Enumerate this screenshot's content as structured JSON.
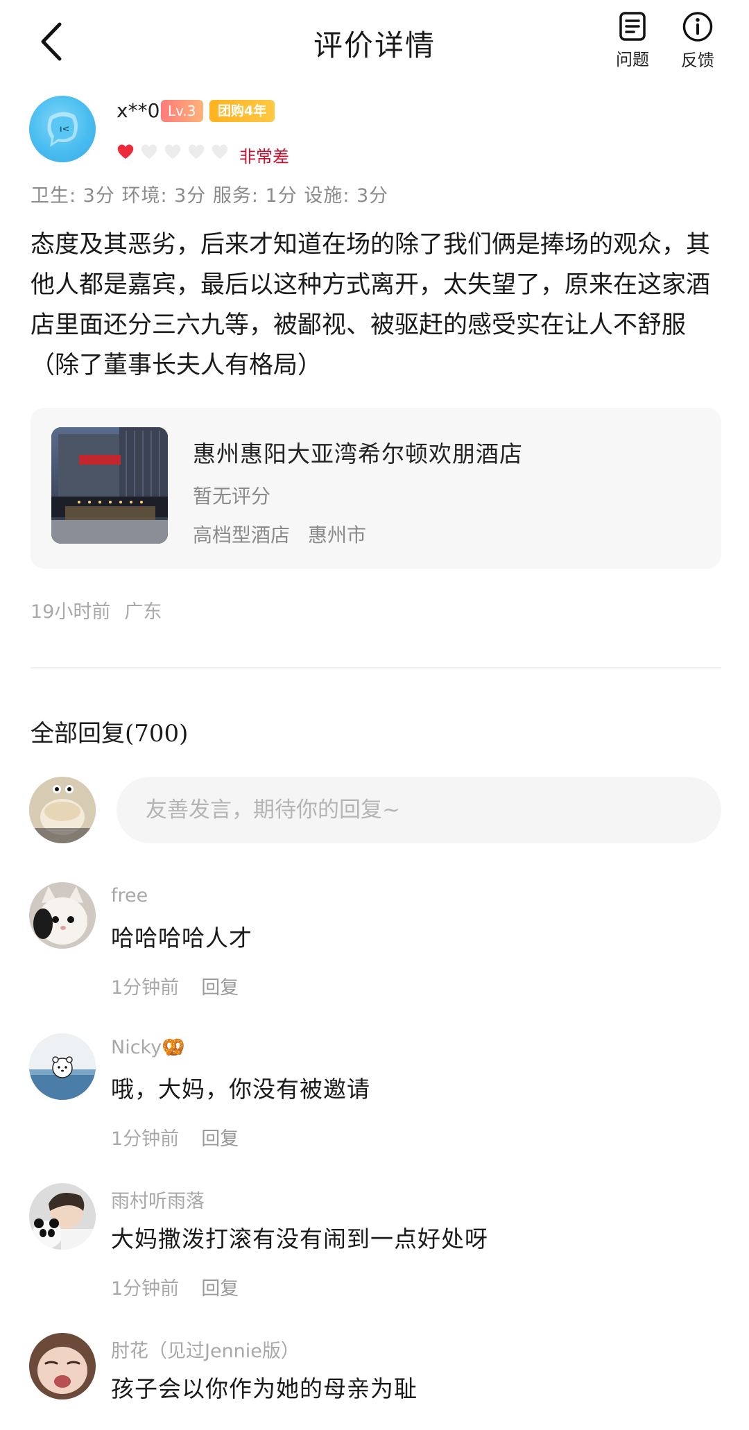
{
  "header": {
    "title": "评价详情",
    "question_label": "问题",
    "feedback_label": "反馈"
  },
  "reviewer": {
    "username": "x**0",
    "level_badge": "Lv.3",
    "years_badge": "团购4年",
    "rating_hearts_filled": 1,
    "rating_hearts_total": 5,
    "rating_text": "非常差",
    "subscores": "卫生: 3分 环境: 3分 服务: 1分 设施: 3分"
  },
  "review": {
    "body": "态度及其恶劣，后来才知道在场的除了我们俩是捧场的观众，其他人都是嘉宾，最后以这种方式离开，太失望了，原来在这家酒店里面还分三六九等，被鄙视、被驱赶的感受实在让人不舒服（除了董事长夫人有格局）"
  },
  "hotel": {
    "name": "惠州惠阳大亚湾希尔顿欢朋酒店",
    "score": "暂无评分",
    "category": "高档型酒店",
    "city": "惠州市"
  },
  "post_meta": {
    "time": "19小时前",
    "location": "广东"
  },
  "replies": {
    "title": "全部回复(700)",
    "composer_placeholder": "友善发言，期待你的回复~",
    "items": [
      {
        "name": "free",
        "text": "哈哈哈哈人才",
        "time": "1分钟前",
        "reply": "回复"
      },
      {
        "name": "Nicky🥨",
        "text": "哦，大妈，你没有被邀请",
        "time": "1分钟前",
        "reply": "回复"
      },
      {
        "name": "雨村听雨落",
        "text": "大妈撒泼打滚有没有闹到一点好处呀",
        "time": "1分钟前",
        "reply": "回复"
      },
      {
        "name": "肘花（见过Jennie版）",
        "text": "孩子会以你作为她的母亲为耻",
        "time": "",
        "reply": ""
      }
    ]
  },
  "colors": {
    "accent_red": "#c8102e",
    "muted_gray": "#a8a8a8",
    "card_bg": "#f7f7f7"
  }
}
